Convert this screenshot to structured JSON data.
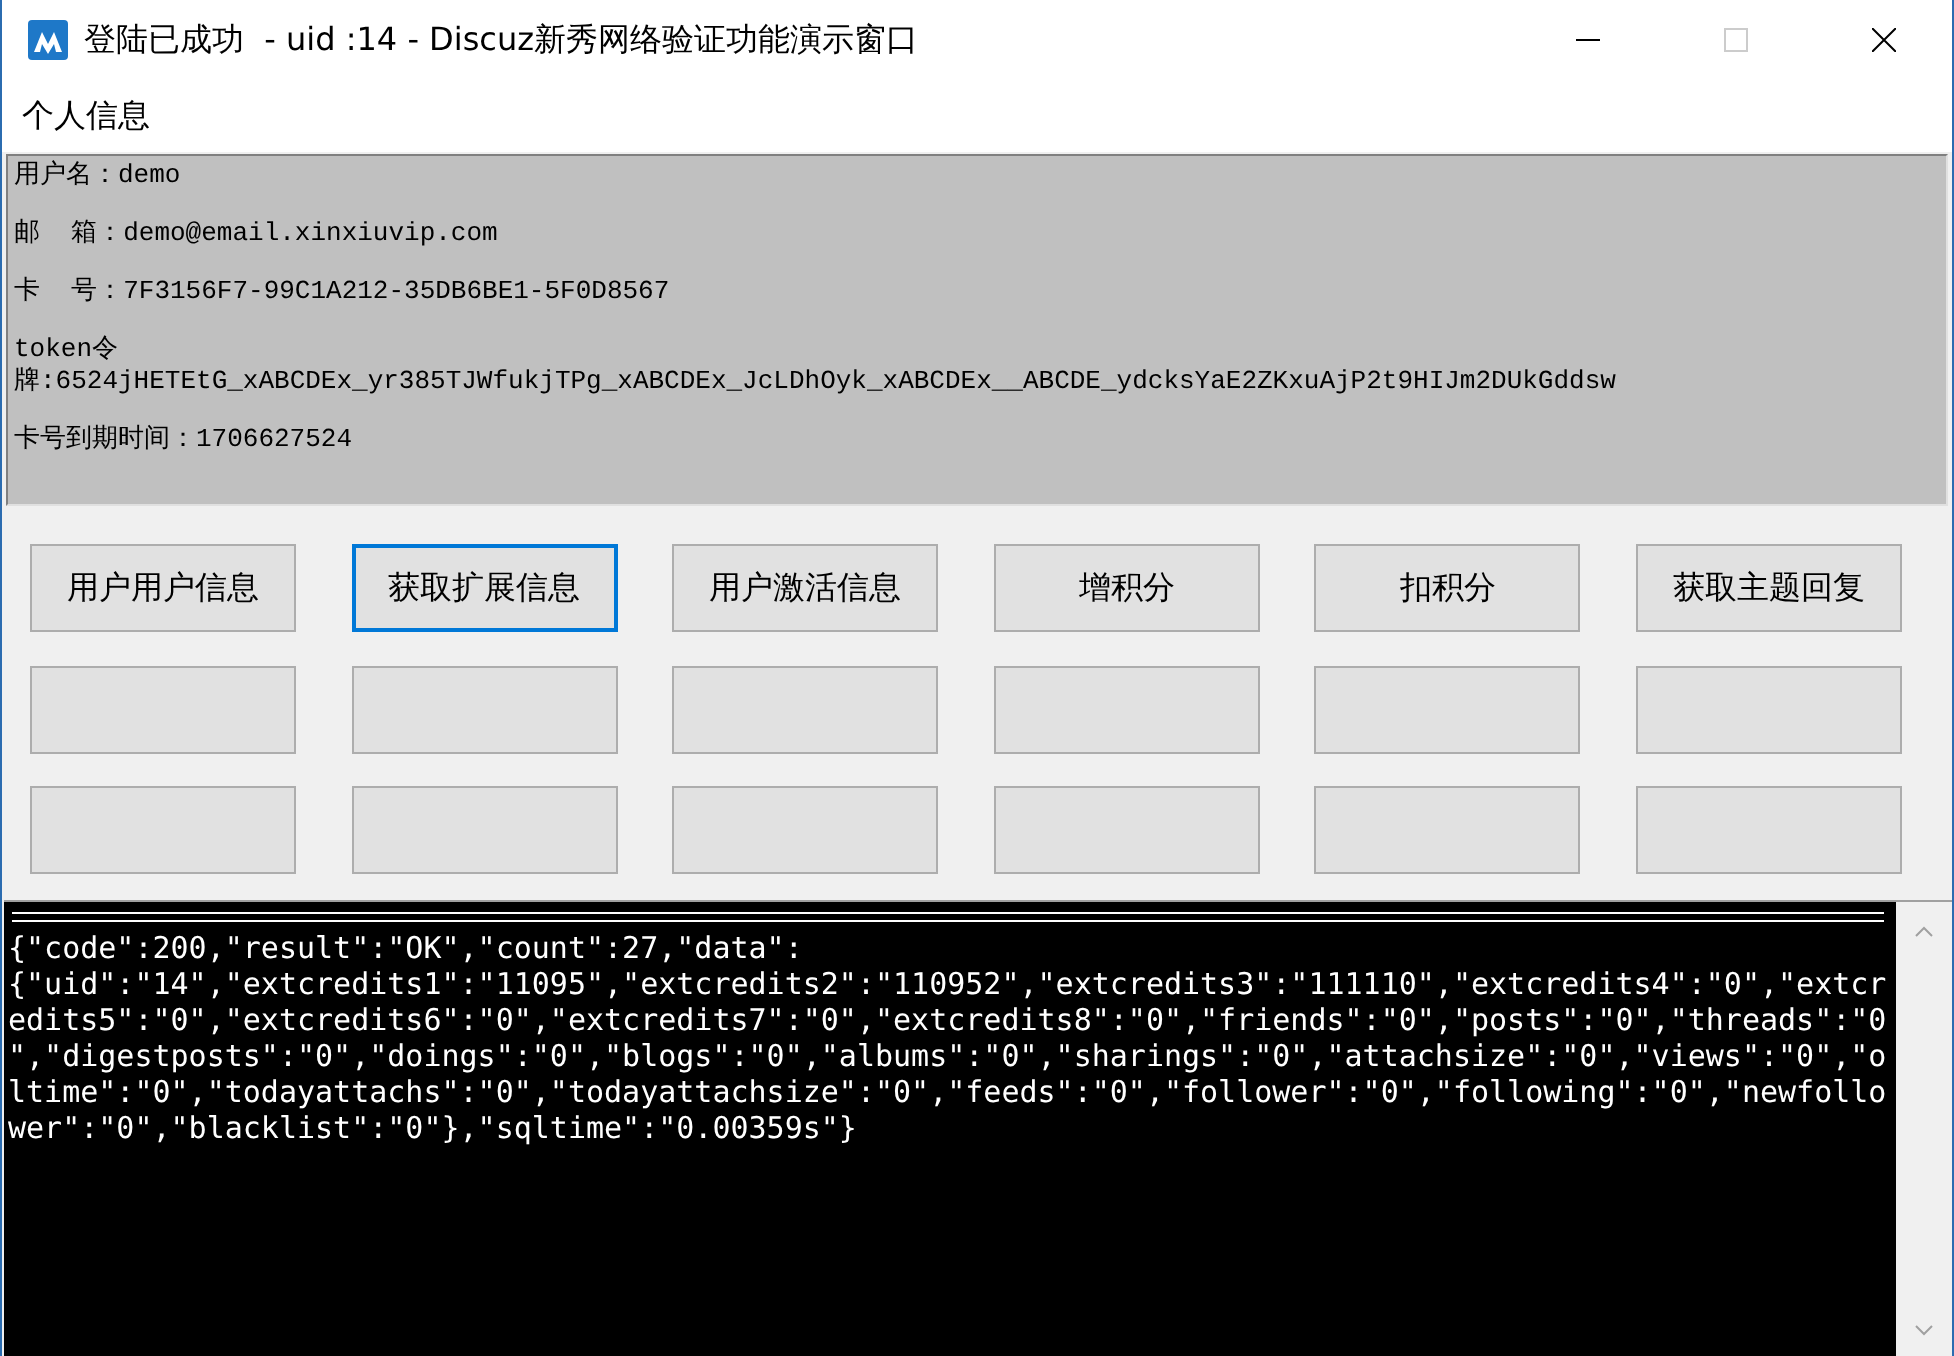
{
  "window": {
    "title": "登陆已成功  - uid :14 - Discuz新秀网络验证功能演示窗口"
  },
  "menu": [
    "个人信息"
  ],
  "info_panel": {
    "items": [
      {
        "lines": [
          "用户名：demo"
        ]
      },
      {
        "lines": [
          "邮  箱：demo@email.xinxiuvip.com"
        ]
      },
      {
        "lines": [
          "卡  号：7F3156F7-99C1A212-35DB6BE1-5F0D8567"
        ]
      },
      {
        "lines": [
          "token令",
          "牌:6524jHETEtG_xABCDEx_yr385TJWfukjTPg_xABCDEx_JcLDhOyk_xABCDEx__ABCDE_ydcksYaE2ZKxuAjP2t9HIJm2DUkGddsw"
        ]
      },
      {
        "lines": [
          "卡号到期时间：1706627524"
        ]
      }
    ]
  },
  "buttons": [
    {
      "kind": "labeled",
      "label": "用户用户信息",
      "focused": false
    },
    {
      "kind": "labeled",
      "label": "获取扩展信息",
      "focused": true
    },
    {
      "kind": "labeled",
      "label": "用户激活信息",
      "focused": false
    },
    {
      "kind": "labeled",
      "label": "增积分",
      "focused": false
    },
    {
      "kind": "labeled",
      "label": "扣积分",
      "focused": false
    },
    {
      "kind": "labeled",
      "label": "获取主题回复",
      "focused": false
    },
    {
      "kind": "blank"
    },
    {
      "kind": "blank"
    },
    {
      "kind": "blank"
    },
    {
      "kind": "blank"
    },
    {
      "kind": "blank"
    },
    {
      "kind": "blank"
    },
    {
      "kind": "blank"
    },
    {
      "kind": "blank"
    },
    {
      "kind": "blank"
    },
    {
      "kind": "blank"
    },
    {
      "kind": "blank"
    },
    {
      "kind": "blank"
    }
  ],
  "output": {
    "lines": [
      "{\"code\":200,\"result\":\"OK\",\"count\":27,\"data\":",
      "{\"uid\":\"14\",\"extcredits1\":\"11095\",\"extcredits2\":\"110952\",\"extcredits3\":\"111110\",\"extcredits4\":\"0\",\"extcr",
      "edits5\":\"0\",\"extcredits6\":\"0\",\"extcredits7\":\"0\",\"extcredits8\":\"0\",\"friends\":\"0\",\"posts\":\"0\",\"threads\":\"0",
      "\",\"digestposts\":\"0\",\"doings\":\"0\",\"blogs\":\"0\",\"albums\":\"0\",\"sharings\":\"0\",\"attachsize\":\"0\",\"views\":\"0\",\"o",
      "ltime\":\"0\",\"todayattachs\":\"0\",\"todayattachsize\":\"0\",\"feeds\":\"0\",\"follower\":\"0\",\"following\":\"0\",\"newfollo",
      "wer\":\"0\",\"blacklist\":\"0\"},\"sqltime\":\"0.00359s\"}"
    ]
  }
}
